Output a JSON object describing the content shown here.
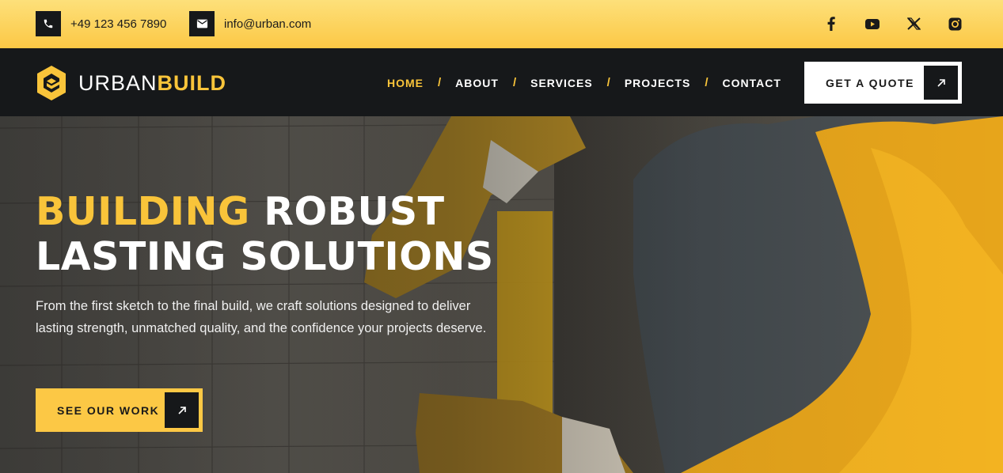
{
  "topbar": {
    "phone": "+49 123 456 7890",
    "email": "info@urban.com",
    "social": [
      {
        "icon": "facebook-icon"
      },
      {
        "icon": "youtube-icon"
      },
      {
        "icon": "x-twitter-icon"
      },
      {
        "icon": "instagram-icon"
      }
    ]
  },
  "brand": {
    "name_part1": "URBAN",
    "name_part2": "BUILD",
    "accent_color": "#f9c43a"
  },
  "nav": {
    "items": [
      {
        "label": "HOME",
        "active": true
      },
      {
        "label": "ABOUT",
        "active": false
      },
      {
        "label": "SERVICES",
        "active": false
      },
      {
        "label": "PROJECTS",
        "active": false
      },
      {
        "label": "CONTACT",
        "active": false
      }
    ],
    "separator": "/",
    "quote_label": "GET A QUOTE"
  },
  "hero": {
    "headline_highlight": "BUILDING",
    "headline_rest1": " ROBUST",
    "headline_line2": "LASTING SOLUTIONS",
    "subtext": "From the first sketch to the final build, we craft solutions designed to deliver lasting strength, unmatched quality, and the confidence your projects deserve.",
    "cta_label": "SEE OUR WORK"
  },
  "colors": {
    "topbar": "#fcc845",
    "nav_bg": "#16181a",
    "accent": "#f9c43a"
  }
}
